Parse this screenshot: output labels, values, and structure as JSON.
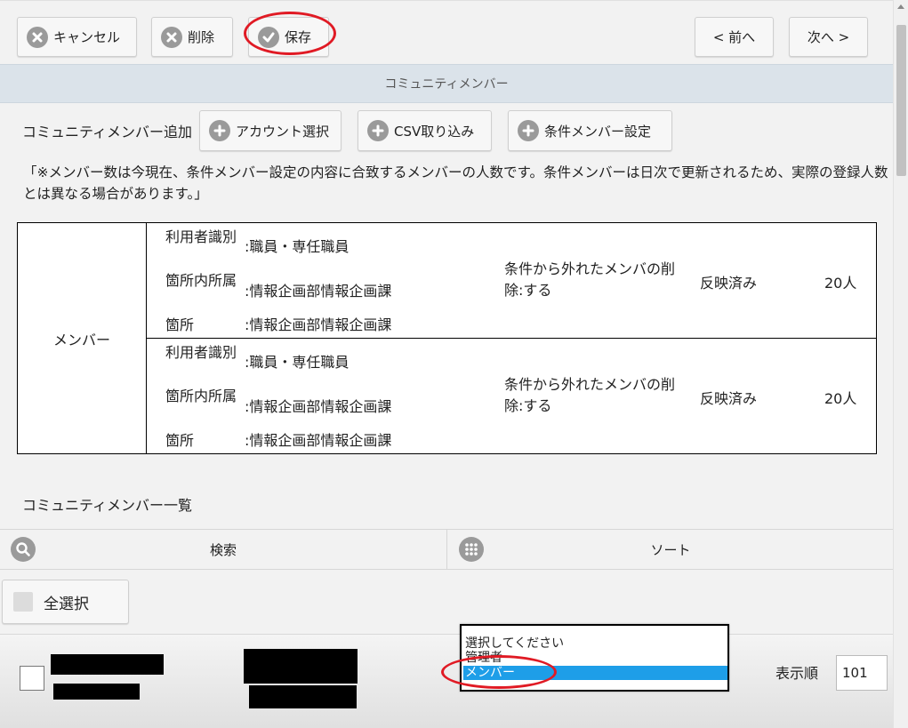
{
  "toolbar": {
    "cancel_label": "キャンセル",
    "delete_label": "削除",
    "save_label": "保存",
    "prev_label": "< 前へ",
    "next_label": "次へ >"
  },
  "section_title": "コミュニティメンバー",
  "add_section": {
    "label": "コミュニティメンバー追加",
    "account_select_label": "アカウント選択",
    "csv_import_label": "CSV取り込み",
    "condition_member_label": "条件メンバー設定"
  },
  "note": "「※メンバー数は今現在、条件メンバー設定の内容に合致するメンバーの人数です。条件メンバーは日次で更新されるため、実際の登録人数とは異なる場合があります。」",
  "member_table": {
    "group_label": "メンバー",
    "rows": [
      {
        "fields": [
          {
            "label": "利用者識別",
            "value": ":職員・専任職員"
          },
          {
            "label": "箇所内所属",
            "value": ":情報企画部情報企画課"
          },
          {
            "label": "箇所",
            "value": ":情報企画部情報企画課"
          }
        ],
        "condition": "条件から外れたメンバの削除:する",
        "status": "反映済み",
        "count": "20人"
      },
      {
        "fields": [
          {
            "label": "利用者識別",
            "value": ":職員・専任職員"
          },
          {
            "label": "箇所内所属",
            "value": ":情報企画部情報企画課"
          },
          {
            "label": "箇所",
            "value": ":情報企画部情報企画課"
          }
        ],
        "condition": "条件から外れたメンバの削除:する",
        "status": "反映済み",
        "count": "20人"
      }
    ]
  },
  "member_list": {
    "title": "コミュニティメンバー一覧",
    "search_label": "検索",
    "sort_label": "ソート",
    "select_all_label": "全選択",
    "role_dropdown": {
      "options": [
        "選択してください",
        "管理者",
        "メンバー"
      ],
      "selected": "メンバー"
    },
    "order_label": "表示順",
    "order_value": "101"
  },
  "colors": {
    "annotation": "#e01a24",
    "selected_option": "#1e9ee8",
    "section_header": "#dbe3ea",
    "icon_gray": "#9a9a9a"
  }
}
